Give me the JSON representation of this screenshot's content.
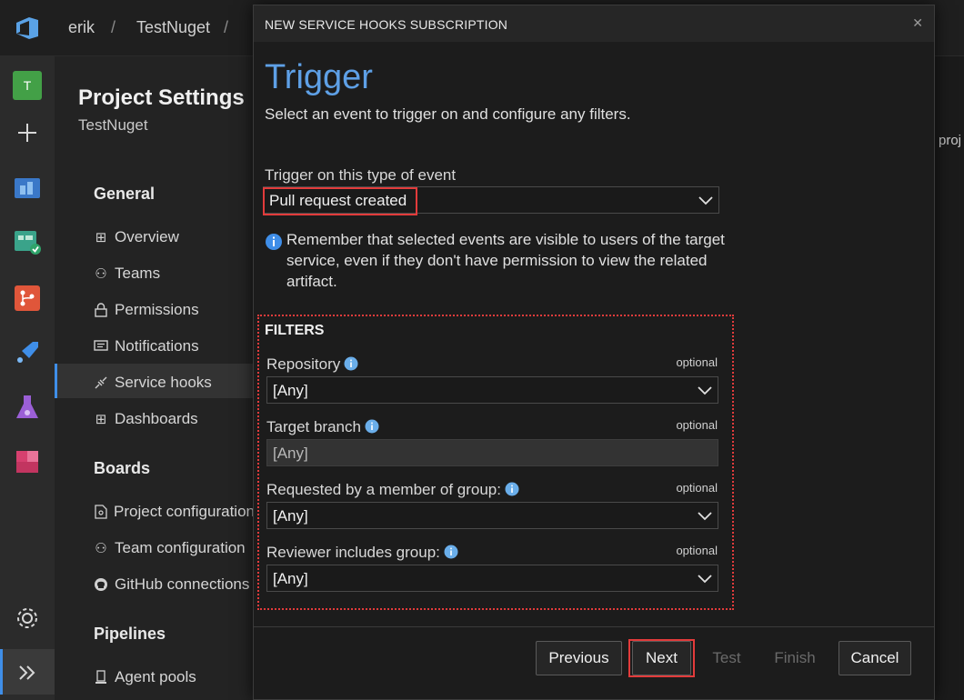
{
  "topbar": {
    "breadcrumb": [
      "erik",
      "TestNuget"
    ],
    "sep": "/",
    "trailing_sep": "/"
  },
  "settings": {
    "title": "Project Settings",
    "subtitle": "TestNuget",
    "general_label": "General",
    "general_items": [
      {
        "label": "Overview",
        "icon": "overview-icon"
      },
      {
        "label": "Teams",
        "icon": "teams-icon"
      },
      {
        "label": "Permissions",
        "icon": "lock-icon"
      },
      {
        "label": "Notifications",
        "icon": "notification-icon"
      },
      {
        "label": "Service hooks",
        "icon": "service-hooks-icon"
      },
      {
        "label": "Dashboards",
        "icon": "dashboard-icon"
      }
    ],
    "boards_label": "Boards",
    "boards_items": [
      {
        "label": "Project configuration",
        "icon": "project-config-icon"
      },
      {
        "label": "Team configuration",
        "icon": "team-config-icon"
      },
      {
        "label": "GitHub connections",
        "icon": "github-icon"
      }
    ],
    "pipelines_label": "Pipelines",
    "pipelines_items": [
      {
        "label": "Agent pools",
        "icon": "agent-pools-icon"
      }
    ]
  },
  "right_fragment": "proj",
  "modal": {
    "header": "NEW SERVICE HOOKS SUBSCRIPTION",
    "title": "Trigger",
    "subtitle": "Select an event to trigger on and configure any filters.",
    "event_label": "Trigger on this type of event",
    "event_value": "Pull request created",
    "info_note": "Remember that selected events are visible to users of the target service, even if they don't have permission to view the related artifact.",
    "filters_title": "FILTERS",
    "filters": [
      {
        "label": "Repository",
        "value": "[Any]",
        "optional": "optional",
        "disabled": false
      },
      {
        "label": "Target branch",
        "value": "[Any]",
        "optional": "optional",
        "disabled": true
      },
      {
        "label": "Requested by a member of group:",
        "value": "[Any]",
        "optional": "optional",
        "disabled": false
      },
      {
        "label": "Reviewer includes group:",
        "value": "[Any]",
        "optional": "optional",
        "disabled": false
      }
    ],
    "buttons": {
      "previous": "Previous",
      "next": "Next",
      "test": "Test",
      "finish": "Finish",
      "cancel": "Cancel"
    }
  },
  "colors": {
    "accent": "#3f8ee8",
    "title_blue": "#5ea0e6",
    "highlight_red": "#e23b3b"
  }
}
